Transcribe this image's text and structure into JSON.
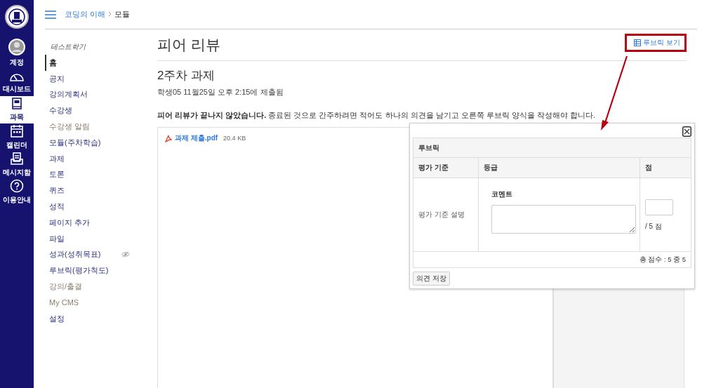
{
  "global_nav": [
    {
      "kind": "logo",
      "selected": false
    },
    {
      "kind": "account",
      "label": "계정",
      "selected": false
    },
    {
      "kind": "dashboard",
      "label": "대시보드",
      "selected": false
    },
    {
      "kind": "courses",
      "label": "과목",
      "selected": true
    },
    {
      "kind": "calendar",
      "label": "캘린더",
      "selected": false
    },
    {
      "kind": "inbox",
      "label": "메시지함",
      "selected": false
    },
    {
      "kind": "help",
      "label": "이용안내",
      "selected": false
    }
  ],
  "breadcrumb": [
    {
      "label": "코딩의 이해",
      "link": true
    },
    {
      "label": "모듈",
      "link": false
    }
  ],
  "course_nav": {
    "term": "테스트학기",
    "items": [
      {
        "label": "홈",
        "selected": true,
        "muted": false,
        "hidden": false
      },
      {
        "label": "공지",
        "selected": false,
        "muted": false,
        "hidden": false
      },
      {
        "label": "강의계획서",
        "selected": false,
        "muted": false,
        "hidden": false
      },
      {
        "label": "수강생",
        "selected": false,
        "muted": false,
        "hidden": false
      },
      {
        "label": "수강생 알림",
        "selected": false,
        "muted": true,
        "hidden": false
      },
      {
        "label": "모듈(주차학습)",
        "selected": false,
        "muted": false,
        "hidden": false
      },
      {
        "label": "과제",
        "selected": false,
        "muted": false,
        "hidden": false
      },
      {
        "label": "토론",
        "selected": false,
        "muted": false,
        "hidden": false
      },
      {
        "label": "퀴즈",
        "selected": false,
        "muted": false,
        "hidden": false
      },
      {
        "label": "성적",
        "selected": false,
        "muted": false,
        "hidden": false
      },
      {
        "label": "페이지 추가",
        "selected": false,
        "muted": false,
        "hidden": false
      },
      {
        "label": "파일",
        "selected": false,
        "muted": false,
        "hidden": false
      },
      {
        "label": "성과(성취목표)",
        "selected": false,
        "muted": false,
        "hidden": true
      },
      {
        "label": "루브릭(평가척도)",
        "selected": false,
        "muted": false,
        "hidden": false
      },
      {
        "label": "강의/출결",
        "selected": false,
        "muted": true,
        "hidden": false
      },
      {
        "label": "My CMS",
        "selected": false,
        "muted": true,
        "hidden": false
      },
      {
        "label": "설정",
        "selected": false,
        "muted": false,
        "hidden": false
      }
    ]
  },
  "page": {
    "title": "피어 리뷰",
    "rubric_link": "루브릭 보기",
    "assignment": "2주차 과제",
    "submitted": "학생05 11월25일 오후 2:15에 제출됨",
    "notice": "**피어 리뷰가 끝나지 않았습니다.** 종료된 것으로 간주하려면 적어도 하나의 의견을 남기고 오른쪽 루브릭 양식을 작성해야 합니다."
  },
  "attachment": {
    "name": "과제 제출.pdf",
    "size": "20.4 KB"
  },
  "rubric": {
    "title": "루브릭",
    "columns": [
      "평가 기준",
      "등급",
      "점"
    ],
    "rows": [
      {
        "criterion": "평가 기준 설명",
        "comment_label": "코멘트",
        "points_suffix": "/ 5 점"
      }
    ],
    "total": "총 점수 : 5 중 5",
    "save_button": "의견 저장"
  }
}
